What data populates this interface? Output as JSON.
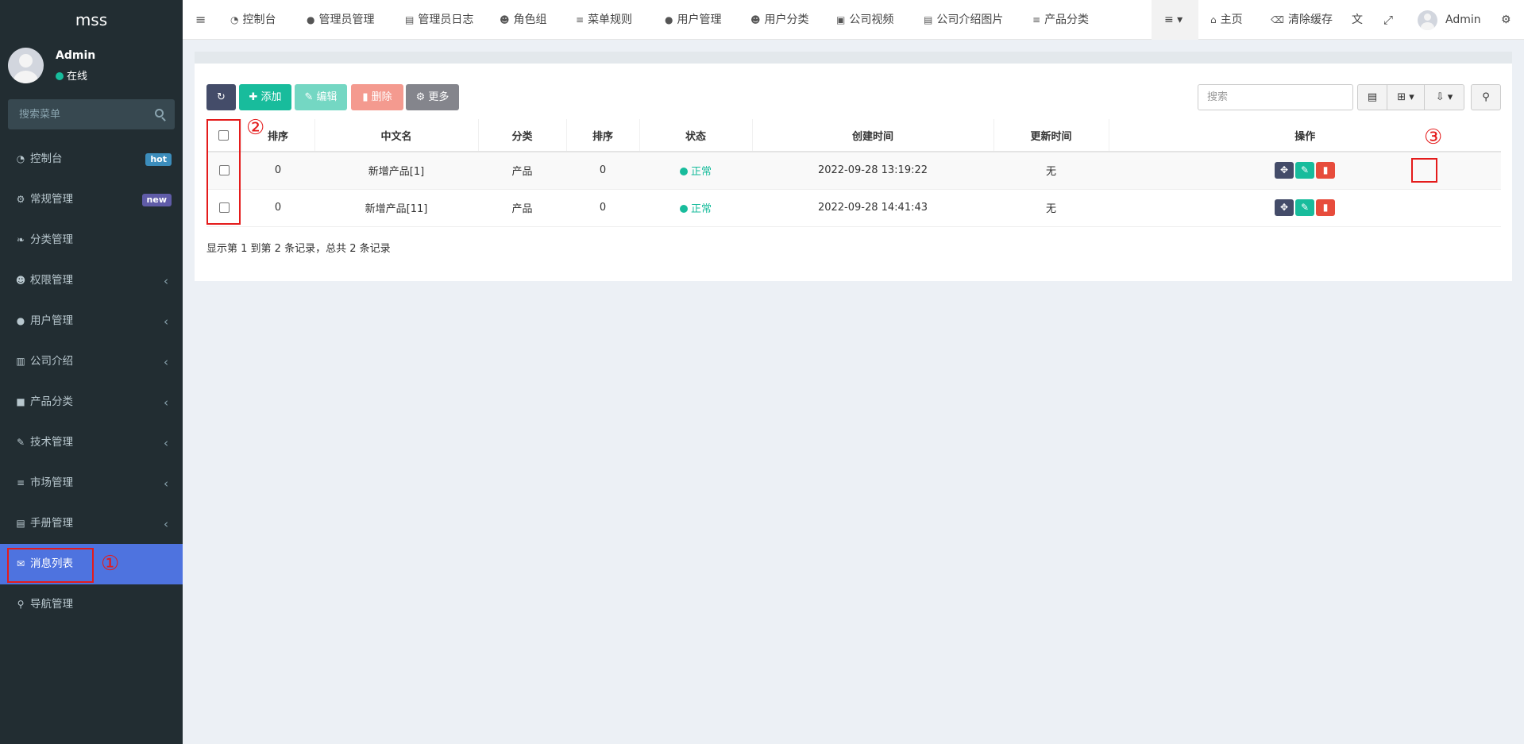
{
  "sidebar": {
    "brand": "mss",
    "user": {
      "name": "Admin",
      "status": "在线"
    },
    "search_placeholder": "搜索菜单",
    "items": [
      {
        "icon": "dashboard-icon",
        "glyph": "◔",
        "label": "控制台",
        "badge": "hot"
      },
      {
        "icon": "cogs-icon",
        "glyph": "⚙",
        "label": "常规管理",
        "badge": "new"
      },
      {
        "icon": "leaf-icon",
        "glyph": "❧",
        "label": "分类管理"
      },
      {
        "icon": "users-icon",
        "glyph": "☻",
        "label": "权限管理",
        "arrow": "‹"
      },
      {
        "icon": "user-circle-icon",
        "glyph": "●",
        "label": "用户管理",
        "arrow": "‹"
      },
      {
        "icon": "bank-icon",
        "glyph": "▥",
        "label": "公司介绍",
        "arrow": "‹"
      },
      {
        "icon": "archive-icon",
        "glyph": "■",
        "label": "产品分类",
        "arrow": "‹"
      },
      {
        "icon": "wrench-icon",
        "glyph": "✎",
        "label": "技术管理",
        "arrow": "‹"
      },
      {
        "icon": "database-icon",
        "glyph": "≡",
        "label": "市场管理",
        "arrow": "‹"
      },
      {
        "icon": "file-icon",
        "glyph": "▤",
        "label": "手册管理",
        "arrow": "‹"
      },
      {
        "icon": "comments-icon",
        "glyph": "✉",
        "label": "消息列表",
        "active": true
      },
      {
        "icon": "thumb-tack-icon",
        "glyph": "⚲",
        "label": "导航管理"
      }
    ]
  },
  "navbar": {
    "toggle_glyph": "≡",
    "tabs": [
      {
        "icon": "dashboard-icon",
        "glyph": "◔",
        "label": "控制台"
      },
      {
        "icon": "user-icon",
        "glyph": "●",
        "label": "管理员管理"
      },
      {
        "icon": "list-alt-icon",
        "glyph": "▤",
        "label": "管理员日志"
      },
      {
        "icon": "group-icon",
        "glyph": "☻",
        "label": "角色组"
      },
      {
        "icon": "bars-icon",
        "glyph": "≡",
        "label": "菜单规则"
      },
      {
        "icon": "user-icon",
        "glyph": "●",
        "label": "用户管理"
      },
      {
        "icon": "users-icon",
        "glyph": "☻",
        "label": "用户分类"
      },
      {
        "icon": "file-video-icon",
        "glyph": "▣",
        "label": "公司视频"
      },
      {
        "icon": "file-image-icon",
        "glyph": "▤",
        "label": "公司介绍图片"
      },
      {
        "icon": "list-icon",
        "glyph": "≡",
        "label": "产品分类"
      }
    ],
    "right": {
      "dropdown_glyph": "≡ ▾",
      "home_glyph": "⌂",
      "home": "主页",
      "clear_glyph": "⌫",
      "clear_cache": "清除缓存",
      "lang_glyph": "文",
      "fullscreen_glyph": "⤢",
      "user": "Admin",
      "settings_glyph": "⚙"
    }
  },
  "toolbar": {
    "refresh_glyph": "↻",
    "add": "✚ 添加",
    "edit": "✎ 编辑",
    "delete": "▮ 删除",
    "more": "⚙ 更多",
    "search_placeholder": "搜索",
    "view_glyph": "▤",
    "columns_glyph": "⊞ ▾",
    "export_glyph": "⇩ ▾",
    "search_glyph": "⚲"
  },
  "table": {
    "headers": [
      "排序",
      "中文名",
      "分类",
      "排序",
      "状态",
      "创建时间",
      "更新时间",
      "操作"
    ],
    "rows": [
      {
        "sort": "0",
        "name": "新增产品[1]",
        "category": "产品",
        "sort2": "0",
        "status": "正常",
        "created": "2022-09-28 13:19:22",
        "updated": "无"
      },
      {
        "sort": "0",
        "name": "新增产品[11]",
        "category": "产品",
        "sort2": "0",
        "status": "正常",
        "created": "2022-09-28 14:41:43",
        "updated": "无"
      }
    ],
    "ops": {
      "drag_glyph": "✥",
      "edit_glyph": "✎",
      "delete_glyph": "▮"
    },
    "summary": "显示第 1 到第 2 条记录，总共 2 条记录"
  },
  "annotations": {
    "m1": "①",
    "m2": "②",
    "m3": "③"
  },
  "colors": {
    "sidebar": "#222d32",
    "active": "#4e73df",
    "success": "#18bc9c",
    "danger": "#e74c3c",
    "marker": "#e41b1b"
  }
}
